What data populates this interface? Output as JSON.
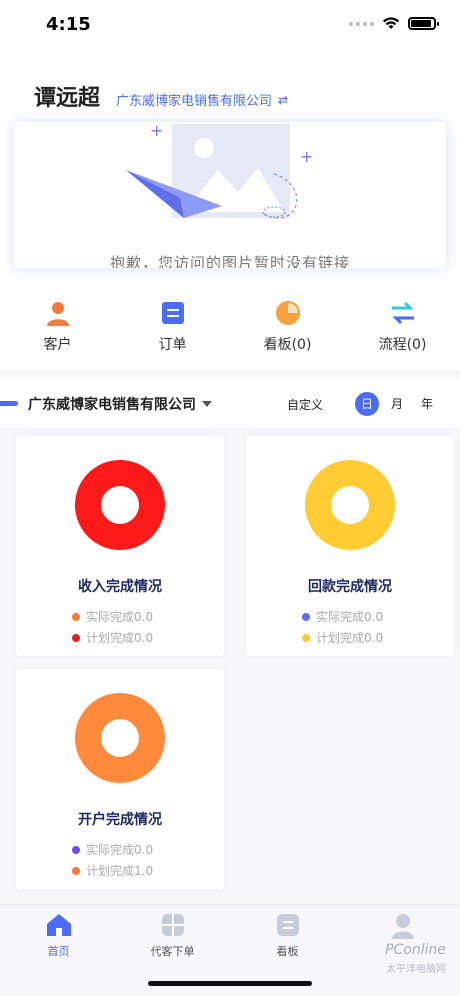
{
  "status_bar": {
    "time": "4:15"
  },
  "header": {
    "user_name": "谭远超",
    "company": "广东威博家电销售有限公司",
    "switch_icon": "swap-icon"
  },
  "banner": {
    "message": "抱歉，您访问的图片暂时没有链接"
  },
  "quick_nav": [
    {
      "label": "客户",
      "icon": "customer-icon",
      "color": "#f47b3c"
    },
    {
      "label": "订单",
      "icon": "order-icon",
      "color": "#4a6cf7"
    },
    {
      "label": "看板(0)",
      "icon": "dashboard-pie-icon",
      "color": "#f6a23a"
    },
    {
      "label": "流程(0)",
      "icon": "process-swap-icon",
      "color": "#2fc7e6"
    }
  ],
  "filter": {
    "company": "广东威博家电销售有限公司",
    "custom_label": "自定义",
    "ranges": [
      "日",
      "月",
      "年"
    ],
    "active_range": "日"
  },
  "cards": [
    {
      "title": "收入完成情况",
      "ring_color": "#ff1a1a",
      "legend": [
        {
          "label": "实际完成0.0",
          "color": "#f47b3c"
        },
        {
          "label": "计划完成0.0",
          "color": "#e02020"
        }
      ]
    },
    {
      "title": "回款完成情况",
      "ring_color": "#ffcc33",
      "legend": [
        {
          "label": "实际完成0.0",
          "color": "#5b6ef0"
        },
        {
          "label": "计划完成0.0",
          "color": "#ffcc33"
        }
      ]
    },
    {
      "title": "开户完成情况",
      "ring_color": "#ff8a3c",
      "legend": [
        {
          "label": "实际完成0.0",
          "color": "#6a4cf0"
        },
        {
          "label": "计划完成1.0",
          "color": "#f47b3c"
        }
      ]
    }
  ],
  "tab_bar": [
    {
      "label": "首页",
      "icon": "home-icon",
      "active": true
    },
    {
      "label": "代客下单",
      "icon": "grid-order-icon",
      "active": false
    },
    {
      "label": "看板",
      "icon": "board-icon",
      "active": false
    },
    {
      "label": "",
      "icon": "profile-icon",
      "active": false
    }
  ],
  "watermark": {
    "text": "PConline",
    "sub": "太平洋电脑网"
  },
  "colors": {
    "accent": "#4a6cf7"
  }
}
